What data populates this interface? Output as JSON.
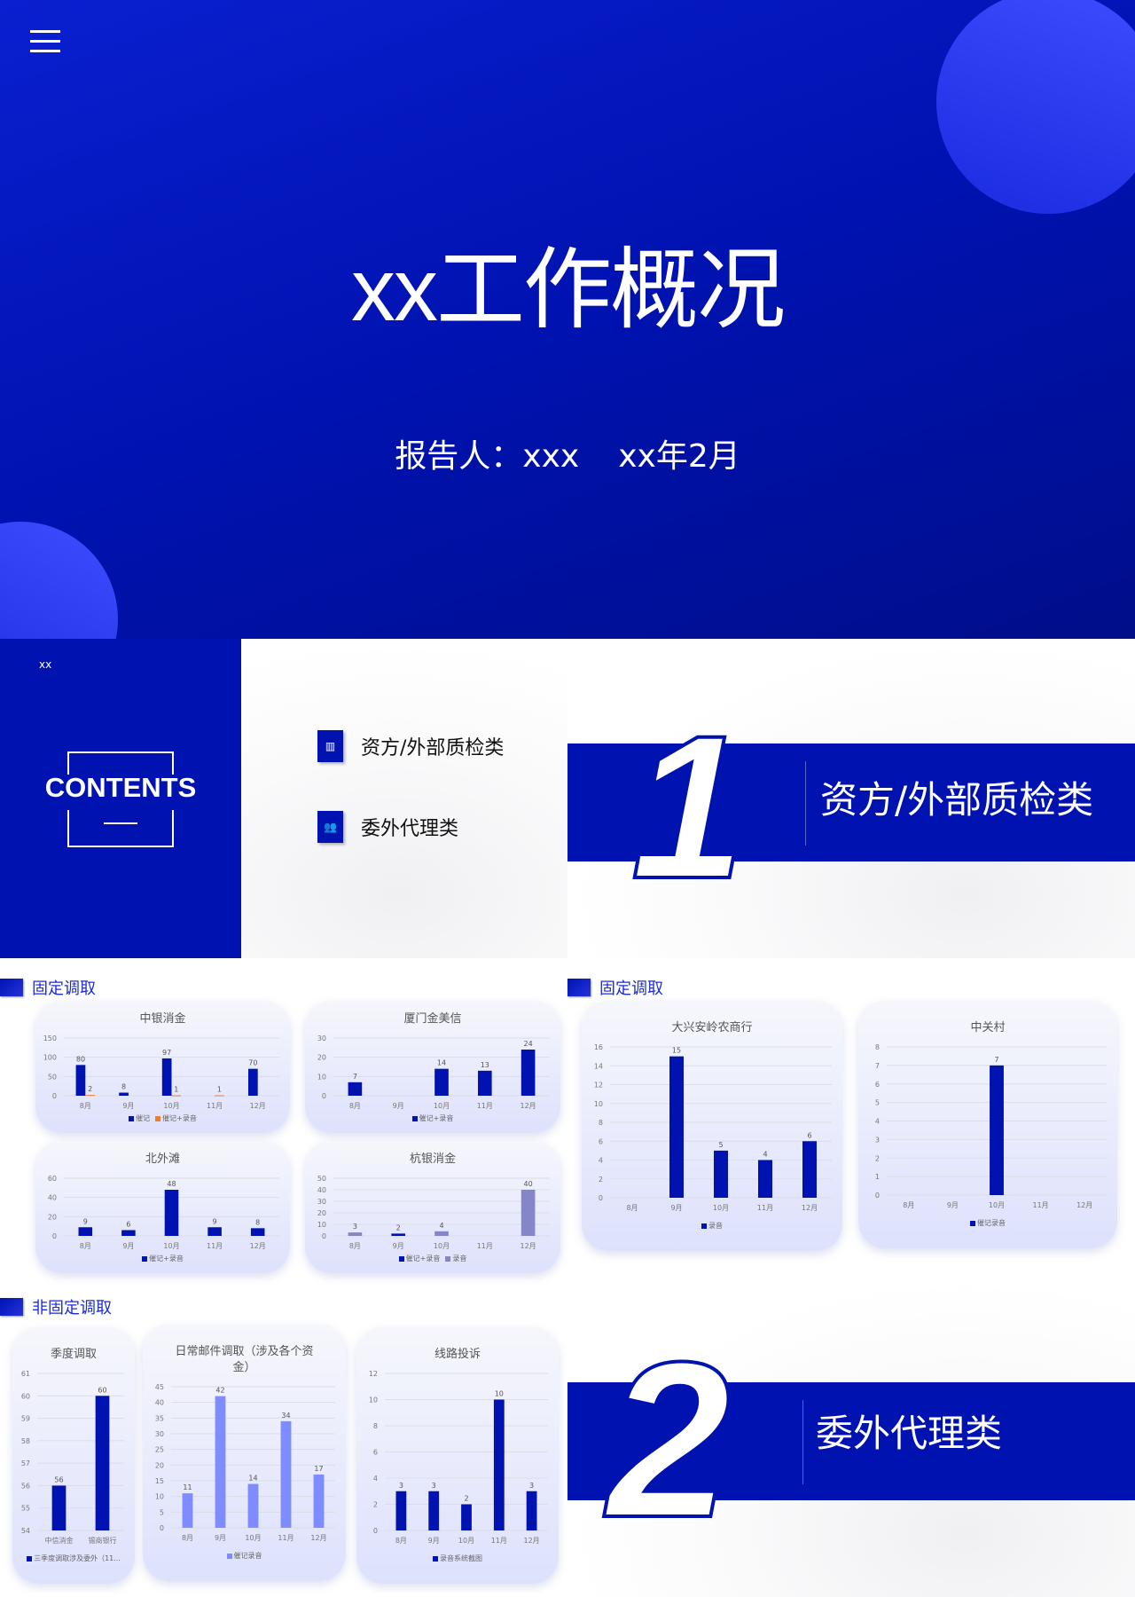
{
  "colors": {
    "primary": "#0012b0",
    "accent_orange": "#ed7d31",
    "light_purple": "#8585c8",
    "light_blue": "#7f8cff",
    "heading": "#1a2bd8"
  },
  "cover": {
    "menu_icon": "hamburger-icon",
    "title": "xx工作概况",
    "reporter": "报告人：xxx",
    "date": "xx年2月"
  },
  "contents": {
    "small": "xx",
    "heading": "CONTENTS",
    "items": [
      {
        "label": "资方/外部质检类",
        "icon": "chart-icon"
      },
      {
        "label": "委外代理类",
        "icon": "people-icon"
      }
    ]
  },
  "section1": {
    "number": "1",
    "title": "资方/外部质检类"
  },
  "section2": {
    "number": "2",
    "title": "委外代理类"
  },
  "headings": {
    "fixed": "固定调取",
    "nonfixed": "非固定调取"
  },
  "chart_data": [
    {
      "id": "c1",
      "type": "bar",
      "title": "中银消金",
      "categories": [
        "8月",
        "9月",
        "10月",
        "11月",
        "12月"
      ],
      "ylim": [
        0,
        150
      ],
      "ystep": 50,
      "mode": "grouped",
      "series": [
        {
          "name": "催记",
          "color": "#0012b0",
          "values": [
            80,
            8,
            97,
            null,
            70
          ]
        },
        {
          "name": "催记+录音",
          "color": "#ed7d31",
          "values": [
            2,
            null,
            1,
            1,
            null
          ]
        }
      ]
    },
    {
      "id": "c2",
      "type": "bar",
      "title": "厦门金美信",
      "categories": [
        "8月",
        "9月",
        "10月",
        "11月",
        "12月"
      ],
      "ylim": [
        0,
        30
      ],
      "ystep": 10,
      "mode": "grouped",
      "series": [
        {
          "name": "催记+录音",
          "color": "#0012b0",
          "values": [
            7,
            null,
            14,
            13,
            24
          ]
        }
      ]
    },
    {
      "id": "c3",
      "type": "bar",
      "title": "北外滩",
      "categories": [
        "8月",
        "9月",
        "10月",
        "11月",
        "12月"
      ],
      "ylim": [
        0,
        60
      ],
      "ystep": 20,
      "mode": "grouped",
      "series": [
        {
          "name": "催记+录音",
          "color": "#0012b0",
          "values": [
            9,
            6,
            48,
            9,
            8
          ]
        }
      ]
    },
    {
      "id": "c4",
      "type": "bar",
      "title": "杭银消金",
      "categories": [
        "8月",
        "9月",
        "10月",
        "11月",
        "12月"
      ],
      "ylim": [
        0,
        50
      ],
      "ystep": 10,
      "mode": "stacked",
      "series": [
        {
          "name": "催记+录音",
          "color": "#0012b0",
          "values": [
            null,
            2,
            null,
            null,
            null
          ]
        },
        {
          "name": "录音",
          "color": "#8585c8",
          "values": [
            3,
            null,
            4,
            null,
            40
          ]
        }
      ]
    },
    {
      "id": "c5",
      "type": "bar",
      "title": "大兴安岭农商行",
      "categories": [
        "8月",
        "9月",
        "10月",
        "11月",
        "12月"
      ],
      "ylim": [
        0,
        16
      ],
      "ystep": 2,
      "mode": "grouped",
      "series": [
        {
          "name": "录音",
          "color": "#0012b0",
          "values": [
            null,
            15,
            5,
            4,
            6
          ]
        }
      ]
    },
    {
      "id": "c6",
      "type": "bar",
      "title": "中关村",
      "categories": [
        "8月",
        "9月",
        "10月",
        "11月",
        "12月"
      ],
      "ylim": [
        0,
        8
      ],
      "ystep": 1,
      "mode": "grouped",
      "series": [
        {
          "name": "催记录音",
          "color": "#0012b0",
          "values": [
            null,
            null,
            7,
            null,
            null
          ]
        }
      ]
    },
    {
      "id": "c7",
      "type": "bar",
      "title": "季度调取",
      "categories": [
        "中信消金",
        "锡商银行"
      ],
      "ylim": [
        54,
        61
      ],
      "ystep": 1,
      "mode": "grouped",
      "series": [
        {
          "name": "三季度调取涉及委外（11...",
          "color": "#0012b0",
          "values": [
            56,
            60
          ]
        }
      ]
    },
    {
      "id": "c8",
      "type": "bar",
      "title": "日常邮件调取（涉及各个资金）",
      "categories": [
        "8月",
        "9月",
        "10月",
        "11月",
        "12月"
      ],
      "ylim": [
        0,
        45
      ],
      "ystep": 5,
      "mode": "grouped",
      "series": [
        {
          "name": "催记录音",
          "color": "#7f8cff",
          "values": [
            11,
            42,
            14,
            34,
            17
          ]
        }
      ]
    },
    {
      "id": "c9",
      "type": "bar",
      "title": "线路投诉",
      "categories": [
        "8月",
        "9月",
        "10月",
        "11月",
        "12月"
      ],
      "ylim": [
        0,
        12
      ],
      "ystep": 2,
      "mode": "grouped",
      "series": [
        {
          "name": "录音系统截图",
          "color": "#0012b0",
          "values": [
            3,
            3,
            2,
            10,
            3
          ]
        }
      ]
    }
  ]
}
